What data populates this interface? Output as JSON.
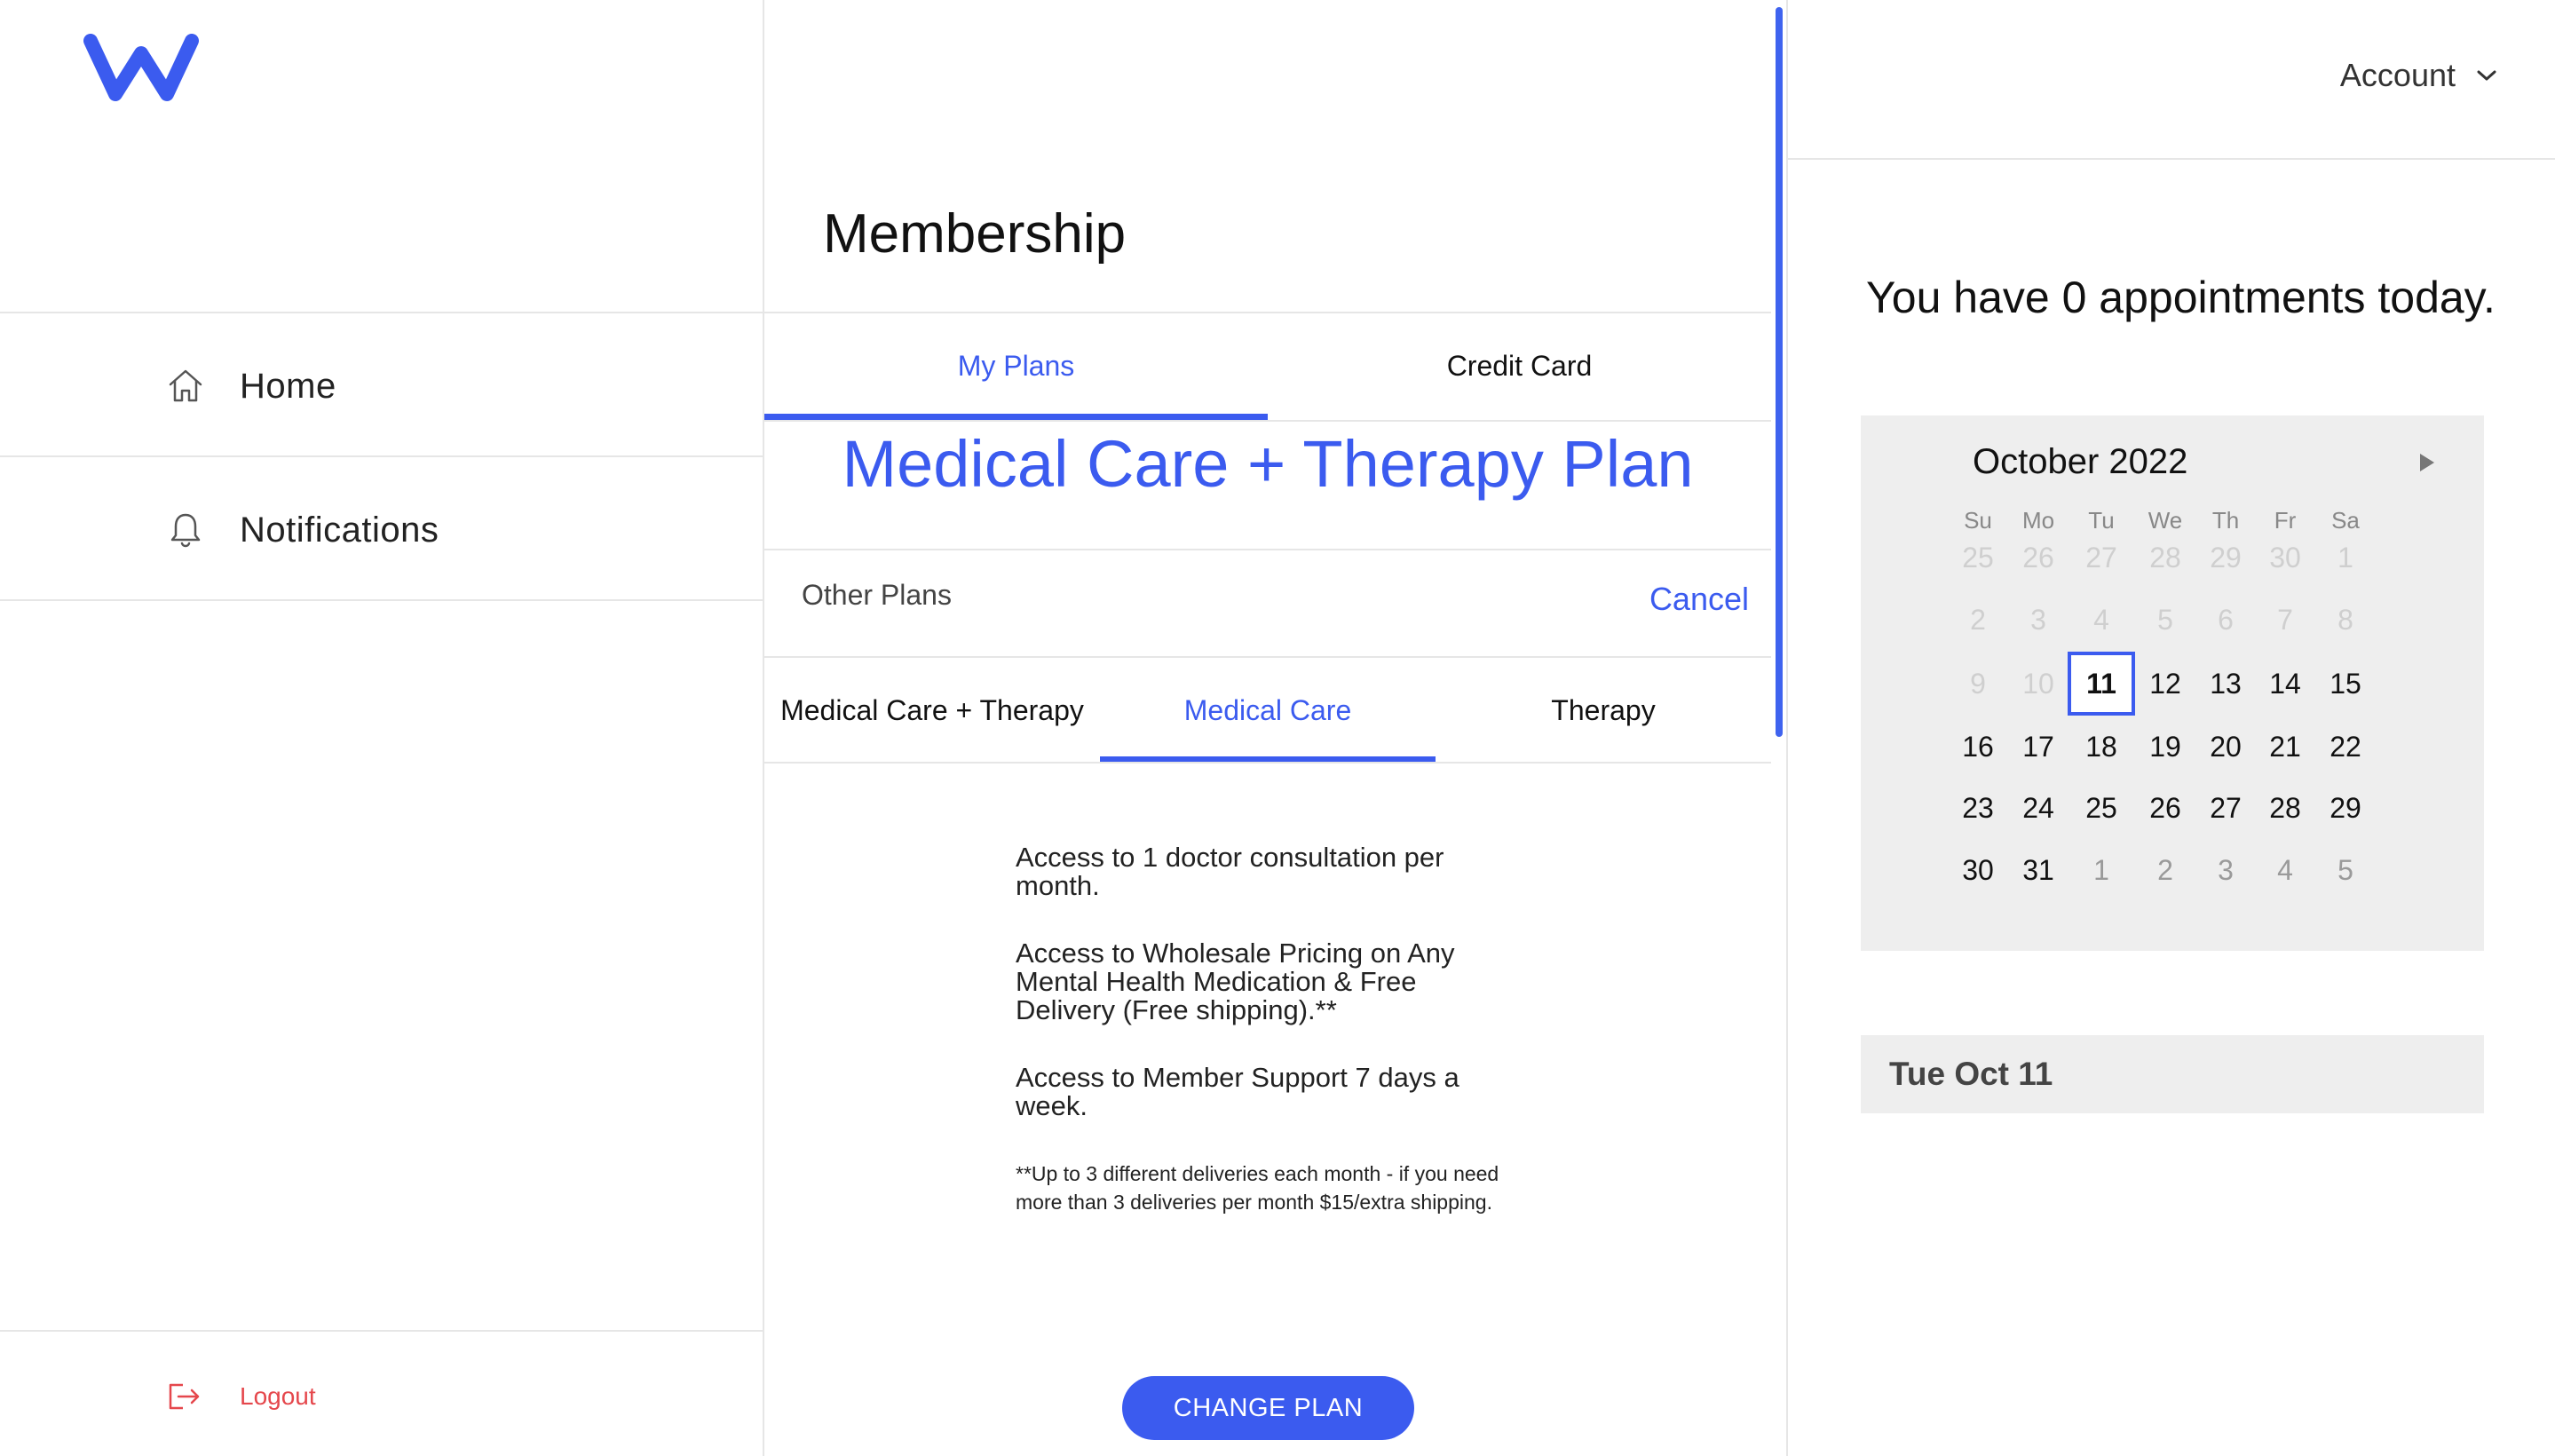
{
  "sidebar": {
    "logo_alt": "W",
    "nav": [
      {
        "label": "Home",
        "icon": "home-icon"
      },
      {
        "label": "Notifications",
        "icon": "bell-icon"
      }
    ],
    "logout_label": "Logout"
  },
  "membership": {
    "title": "Membership",
    "tabs": [
      {
        "label": "My Plans",
        "active": true
      },
      {
        "label": "Credit Card",
        "active": false
      }
    ],
    "plan_title": "Medical Care + Therapy Plan",
    "other_plans_label": "Other Plans",
    "cancel_label": "Cancel",
    "plan_tabs": [
      {
        "label": "Medical Care + Therapy",
        "active": false
      },
      {
        "label": "Medical Care",
        "active": true
      },
      {
        "label": "Therapy",
        "active": false
      }
    ],
    "features": [
      "Access to 1 doctor consultation per month.",
      "Access to Wholesale Pricing on Any Mental Health Medication & Free Delivery (Free shipping).**",
      "Access to Member Support 7 days a week."
    ],
    "footnote": "**Up to 3 different deliveries each month - if you need more than 3 deliveries per month $15/extra shipping.",
    "change_plan_label": "CHANGE PLAN"
  },
  "right": {
    "account_label": "Account",
    "appointments_message": "You have 0 appointments today.",
    "calendar": {
      "month_label": "October 2022",
      "weekdays": [
        "Su",
        "Mo",
        "Tu",
        "We",
        "Th",
        "Fr",
        "Sa"
      ],
      "weeks": [
        [
          [
            "25",
            "muted"
          ],
          [
            "26",
            "muted"
          ],
          [
            "27",
            "muted"
          ],
          [
            "28",
            "muted"
          ],
          [
            "29",
            "muted"
          ],
          [
            "30",
            "muted"
          ],
          [
            "1",
            "muted"
          ]
        ],
        [
          [
            "2",
            "muted"
          ],
          [
            "3",
            "muted"
          ],
          [
            "4",
            "muted"
          ],
          [
            "5",
            "muted"
          ],
          [
            "6",
            "muted"
          ],
          [
            "7",
            "muted"
          ],
          [
            "8",
            "muted"
          ]
        ],
        [
          [
            "9",
            "muted"
          ],
          [
            "10",
            "muted"
          ],
          [
            "11",
            "today"
          ],
          [
            "12",
            "normal"
          ],
          [
            "13",
            "normal"
          ],
          [
            "14",
            "normal"
          ],
          [
            "15",
            "normal"
          ]
        ],
        [
          [
            "16",
            "normal"
          ],
          [
            "17",
            "normal"
          ],
          [
            "18",
            "normal"
          ],
          [
            "19",
            "normal"
          ],
          [
            "20",
            "normal"
          ],
          [
            "21",
            "normal"
          ],
          [
            "22",
            "normal"
          ]
        ],
        [
          [
            "23",
            "normal"
          ],
          [
            "24",
            "normal"
          ],
          [
            "25",
            "normal"
          ],
          [
            "26",
            "normal"
          ],
          [
            "27",
            "normal"
          ],
          [
            "28",
            "normal"
          ],
          [
            "29",
            "normal"
          ]
        ],
        [
          [
            "30",
            "normal"
          ],
          [
            "31",
            "normal"
          ],
          [
            "1",
            "other"
          ],
          [
            "2",
            "other"
          ],
          [
            "3",
            "other"
          ],
          [
            "4",
            "other"
          ],
          [
            "5",
            "other"
          ]
        ]
      ]
    },
    "selected_date_label": "Tue Oct 11"
  },
  "colors": {
    "accent": "#3b5bef",
    "logout": "#e5474c",
    "panel_gray": "#eeeeee",
    "divider": "#e6e6e6"
  }
}
